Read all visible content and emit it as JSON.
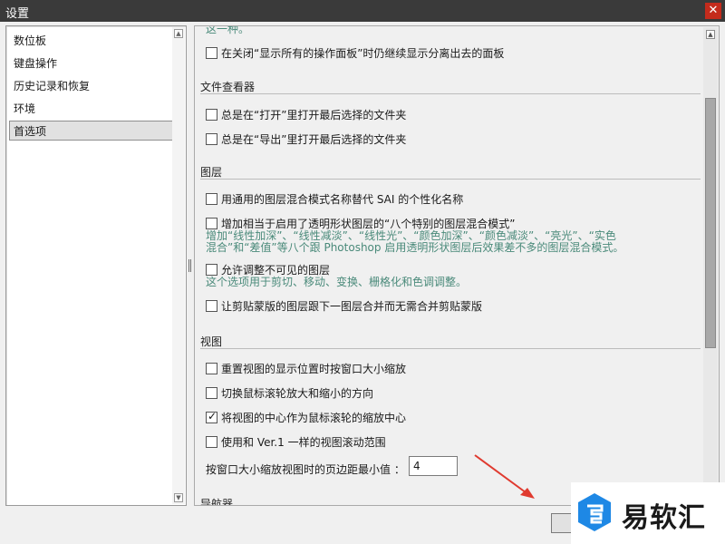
{
  "window": {
    "title": "设置",
    "close_glyph": "✕"
  },
  "sidebar": {
    "items": [
      {
        "label": "数位板",
        "selected": false
      },
      {
        "label": "键盘操作",
        "selected": false
      },
      {
        "label": "历史记录和恢复",
        "selected": false
      },
      {
        "label": "环境",
        "selected": false
      },
      {
        "label": "首选项",
        "selected": true
      }
    ]
  },
  "panel": {
    "top_fragment": "这一种。",
    "rows": {
      "keep_panels": {
        "label": "在关闭“显示所有的操作面板”时仍继续显示分离出去的面板",
        "checked": false
      },
      "open_last": {
        "label": "总是在“打开”里打开最后选择的文件夹",
        "checked": false
      },
      "export_last": {
        "label": "总是在“导出”里打开最后选择的文件夹",
        "checked": false
      },
      "generic_names": {
        "label": "用通用的图层混合模式名称替代 SAI 的个性化名称",
        "checked": false
      },
      "eight_modes": {
        "label": "增加相当于启用了透明形状图层的“八个特别的图层混合模式”",
        "checked": false
      },
      "edit_invisible": {
        "label": "允许调整不可见的图层",
        "checked": false
      },
      "clip_merge": {
        "label": "让剪贴蒙版的图层跟下一图层合并而无需合并剪贴蒙版",
        "checked": false
      },
      "reset_view": {
        "label": "重置视图的显示位置时按窗口大小缩放",
        "checked": false
      },
      "wheel_dir": {
        "label": "切换鼠标滚轮放大和缩小的方向",
        "checked": false
      },
      "wheel_center": {
        "label": "将视图的中心作为鼠标滚轮的缩放中心",
        "checked": true
      },
      "ver1_scroll": {
        "label": "使用和 Ver.1 一样的视图滚动范围",
        "checked": false
      }
    },
    "sections": {
      "file_viewer": "文件查看器",
      "layers": "图层",
      "view": "视图",
      "navigator": "导航器"
    },
    "descriptions": {
      "eight_modes_1": "增加“线性加深”、“线性减淡”、“线性光”、“颜色加深”、“颜色减淡”、“亮光”、“实色",
      "eight_modes_2": "混合”和“差值”等八个跟 Photoshop 启用透明形状图层后效果差不多的图层混合模式。",
      "edit_invisible": "这个选项用于剪切、移动、变换、栅格化和色调调整。"
    },
    "min_margin": {
      "label": "按窗口大小缩放视图时的页边距最小值 ：",
      "value": "4"
    }
  },
  "watermark": {
    "text": "易软汇"
  },
  "colors": {
    "description": "#4a8a7a",
    "annotation_arrow": "#e03a2f",
    "logo_blue": "#1e88e5"
  },
  "icons": {
    "close": "close-icon",
    "checkmark": "checkmark-icon",
    "scroll_up": "chevron-up-icon",
    "scroll_down": "chevron-down-icon"
  }
}
